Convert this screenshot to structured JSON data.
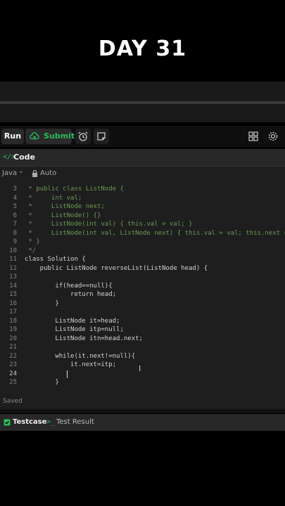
{
  "overlay_title": "DAY 31",
  "toolbar": {
    "run_label": "Run",
    "submit_label": "Submit"
  },
  "code_tab": {
    "label": "Code"
  },
  "langbar": {
    "language": "Java",
    "autocomplete": "Auto"
  },
  "editor": {
    "lines": [
      {
        "num": "3",
        "text": " * public class ListNode {"
      },
      {
        "num": "4",
        "text": " *     int val;"
      },
      {
        "num": "5",
        "text": " *     ListNode next;"
      },
      {
        "num": "6",
        "text": " *     ListNode() {}"
      },
      {
        "num": "7",
        "text": " *     ListNode(int val) { this.val = val; }"
      },
      {
        "num": "8",
        "text": " *     ListNode(int val, ListNode next) { this.val = val; this.next = next; }"
      },
      {
        "num": "9",
        "text": " * }"
      },
      {
        "num": "10",
        "text": " */"
      },
      {
        "num": "11",
        "text": "class Solution {"
      },
      {
        "num": "12",
        "text": "    public ListNode reverseList(ListNode head) {"
      },
      {
        "num": "13",
        "text": ""
      },
      {
        "num": "14",
        "text": "        if(head==null){"
      },
      {
        "num": "15",
        "text": "            return head;"
      },
      {
        "num": "16",
        "text": "        }"
      },
      {
        "num": "17",
        "text": ""
      },
      {
        "num": "18",
        "text": "        ListNode it=head;"
      },
      {
        "num": "19",
        "text": "        ListNode itp=null;"
      },
      {
        "num": "20",
        "text": "        ListNode itn=head.next;"
      },
      {
        "num": "21",
        "text": ""
      },
      {
        "num": "22",
        "text": "        while(it.next!=null){"
      },
      {
        "num": "23",
        "text": "            it.next=itp;"
      },
      {
        "num": "24",
        "text": "            "
      },
      {
        "num": "25",
        "text": "        }"
      }
    ]
  },
  "status": {
    "saved": "Saved"
  },
  "bottom_tabs": {
    "testcase": "Testcase",
    "test_result": "Test Result"
  },
  "colors": {
    "accent_green": "#2cbb5d",
    "background": "#000000",
    "editor_bg": "#1e1e1e"
  }
}
